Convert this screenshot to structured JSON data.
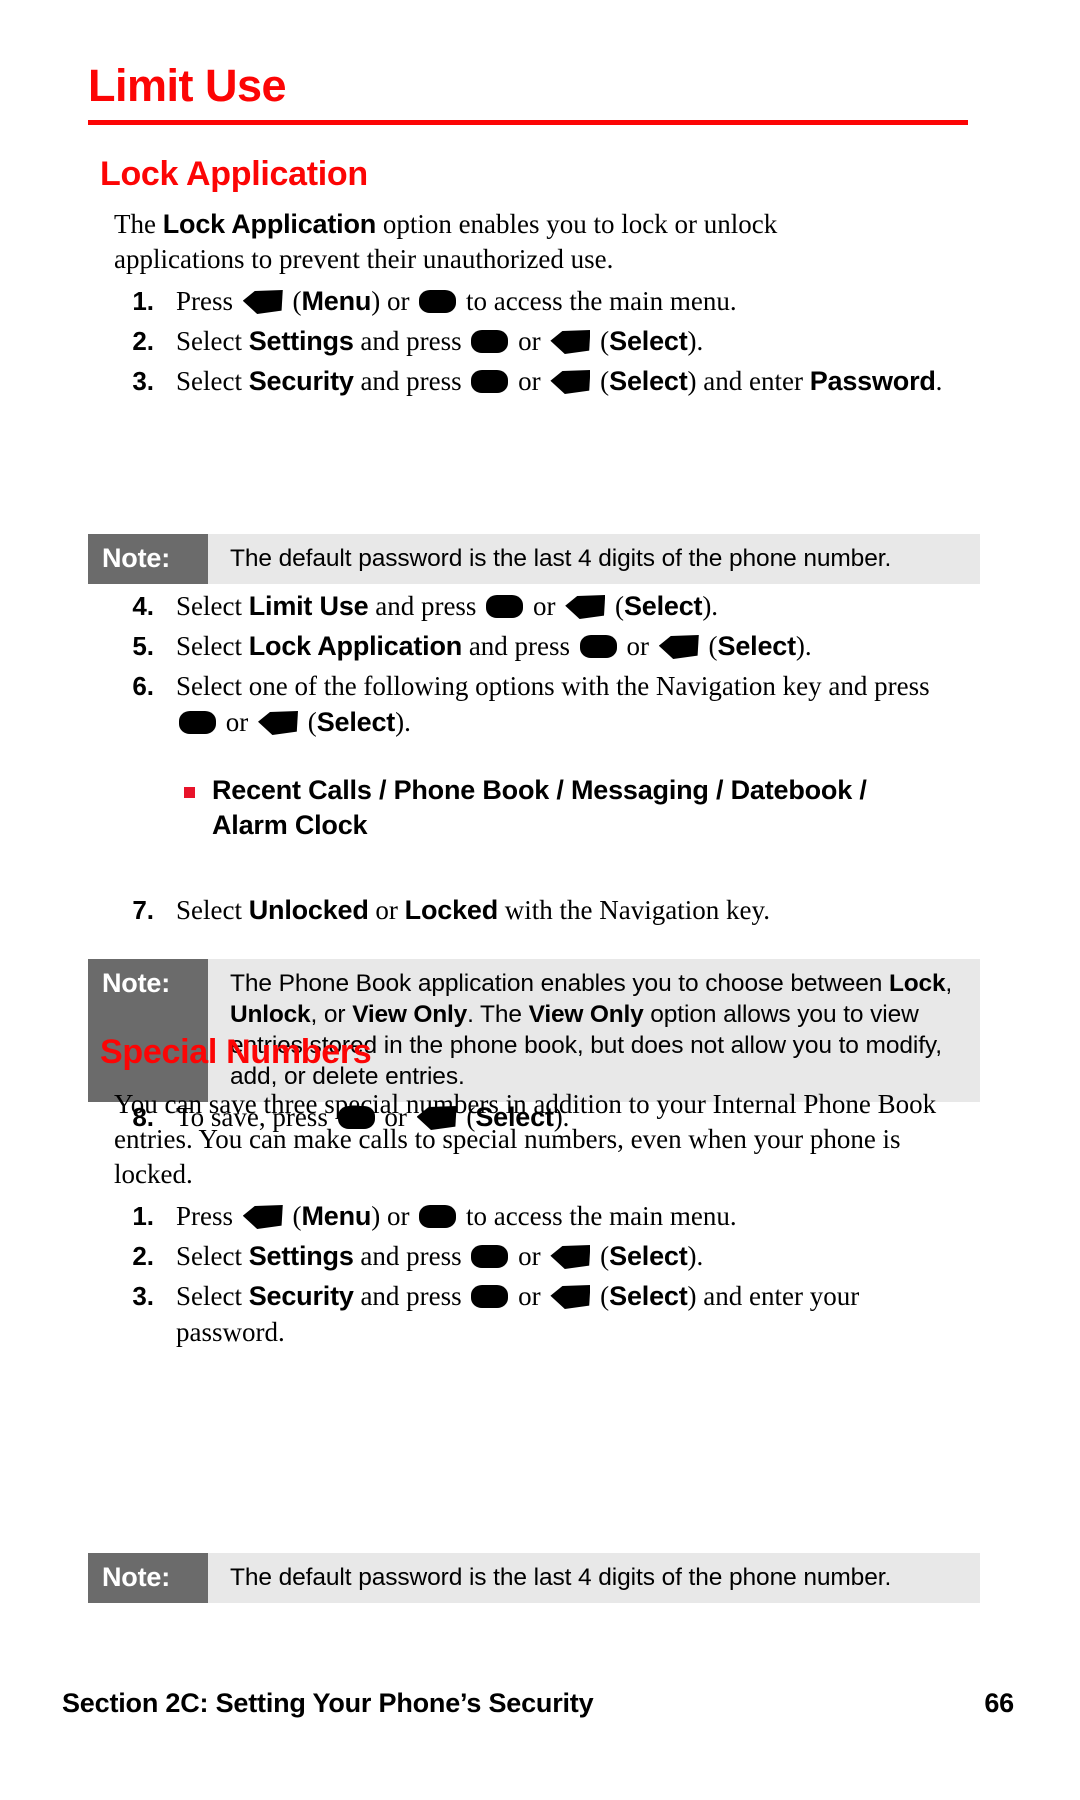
{
  "page": {
    "title": "Limit Use",
    "footer_section": "Section 2C: Setting Your Phone’s Security",
    "footer_page_number": "66",
    "accent_color": "#fc0505",
    "bullet_color": "#e8132a",
    "note_label_bg": "#6b6b6b",
    "note_body_bg": "#e8e8e8"
  },
  "sections": {
    "lock_application": {
      "heading": "Lock Application",
      "intro_a": "The ",
      "intro_bold": "Lock Application",
      "intro_b": " option enables you to lock or unlock applications to prevent their unauthorized use.",
      "steps": {
        "s1": {
          "num": "1.",
          "t1": "Press",
          "icon1": "softkey-icon",
          "t2": "(",
          "b1": "Menu",
          "t3": ") or",
          "icon2": "ok-key-icon",
          "t4": "to access the main menu."
        },
        "s2": {
          "num": "2.",
          "t1": "Select",
          "b1": "Settings",
          "t2": "and press",
          "icon1": "ok-key-icon",
          "t3": "or",
          "icon2": "softkey-icon",
          "t4": "(",
          "b2": "Select",
          "t5": ")."
        },
        "s3": {
          "num": "3.",
          "t1": "Select",
          "b1": "Security",
          "t2": "and press",
          "icon1": "ok-key-icon",
          "t3": "or",
          "icon2": "softkey-icon",
          "t4": "(",
          "b2": "Select",
          "t5": ") and enter",
          "b3": "Password",
          "t6": "."
        },
        "s4": {
          "num": "4.",
          "t1": "Select",
          "b1": "Limit Use",
          "t2": "and press",
          "icon1": "ok-key-icon",
          "t3": "or",
          "icon2": "softkey-icon",
          "t4": "(",
          "b2": "Select",
          "t5": ")."
        },
        "s5": {
          "num": "5.",
          "t1": "Select",
          "b1": "Lock Application",
          "t2": "and press",
          "icon1": "ok-key-icon",
          "t3": "or",
          "icon2": "softkey-icon",
          "t4": "(",
          "b2": "Select",
          "t5": ")."
        },
        "s6": {
          "num": "6.",
          "t1": "Select one of the following options with the Navigation key and press",
          "icon1": "ok-key-icon",
          "t2": "or",
          "icon2": "softkey-icon",
          "t3": "(",
          "b1": "Select",
          "t4": ")."
        },
        "s7": {
          "num": "7.",
          "t1": "Select",
          "b1": "Unlocked",
          "t2": "or",
          "b2": "Locked",
          "t3": "with the Navigation key."
        },
        "s8": {
          "num": "8.",
          "t1": "To save, press",
          "icon1": "ok-key-icon",
          "t2": "or",
          "icon2": "softkey-icon",
          "t3": "(",
          "b1": "Select",
          "t4": ")."
        }
      },
      "options_bullet": {
        "line1_items": [
          "Recent Calls",
          "Phone Book",
          "Messaging",
          "Datebook"
        ],
        "line1": "Recent Calls / Phone Book / Messaging / Datebook /",
        "line2": "Alarm Clock"
      },
      "note1": {
        "label": "Note:",
        "text": "The default password is the last 4 digits of the phone number."
      },
      "note2": {
        "label": "Note:",
        "p1": "The Phone Book application enables you to choose between ",
        "b1": "Lock",
        "p2": ", ",
        "b2": "Unlock",
        "p3": ", or ",
        "b3": "View Only",
        "p4": ". The ",
        "b4": "View Only",
        "p5": " option allows you to view entries stored in the phone book, but does not allow you to modify, add, or delete entries."
      }
    },
    "special_numbers": {
      "heading": "Special Numbers",
      "intro": "You can save three special numbers in addition to your Internal Phone Book entries. You can make calls to special numbers, even when your phone is locked.",
      "steps": {
        "s1": {
          "num": "1.",
          "t1": "Press",
          "icon1": "softkey-icon",
          "t2": "(",
          "b1": "Menu",
          "t3": ") or",
          "icon2": "ok-key-icon",
          "t4": "to access the main menu."
        },
        "s2": {
          "num": "2.",
          "t1": "Select",
          "b1": "Settings",
          "t2": "and press",
          "icon1": "ok-key-icon",
          "t3": "or",
          "icon2": "softkey-icon",
          "t4": "(",
          "b2": "Select",
          "t5": ")."
        },
        "s3": {
          "num": "3.",
          "t1": "Select",
          "b1": "Security",
          "t2": "and press",
          "icon1": "ok-key-icon",
          "t3": "or",
          "icon2": "softkey-icon",
          "t4": "(",
          "b2": "Select",
          "t5": ") and enter your password."
        }
      },
      "note1": {
        "label": "Note:",
        "text": "The default password is the last 4 digits of the phone number."
      }
    }
  }
}
